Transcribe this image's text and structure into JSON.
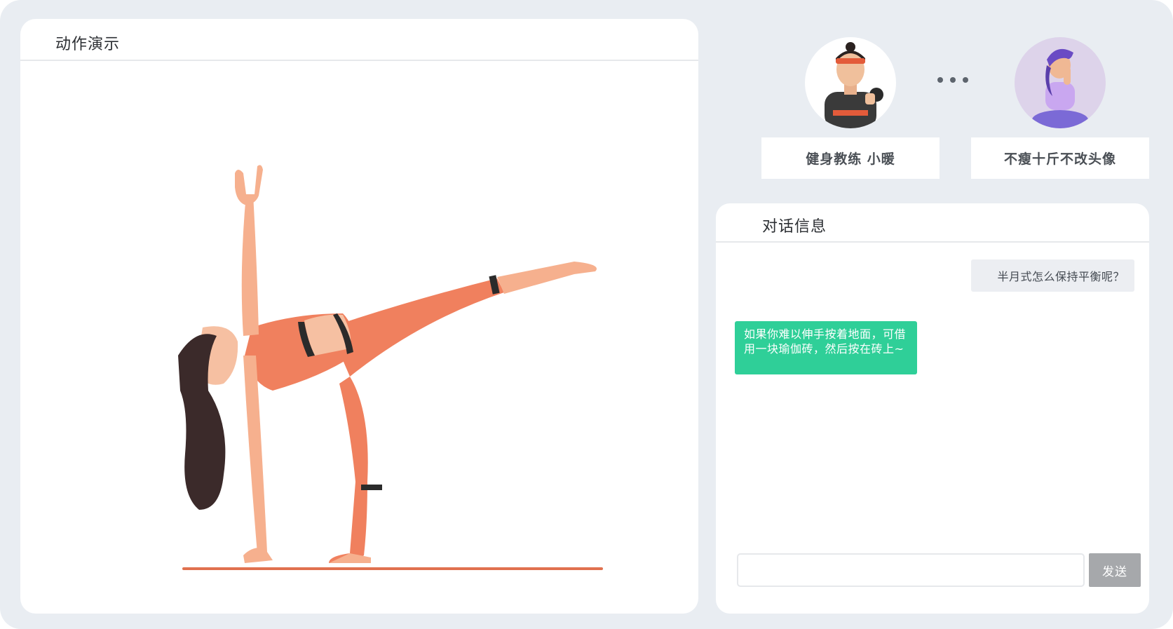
{
  "demo": {
    "title": "动作演示"
  },
  "participants": {
    "coach": {
      "name": "健身教练 小暖",
      "avatar_icon": "coach-avatar-icon"
    },
    "user": {
      "name": "不瘦十斤不改头像",
      "avatar_icon": "user-avatar-icon"
    },
    "connector_icon": "ellipsis-icon"
  },
  "chat": {
    "title": "对话信息",
    "messages": [
      {
        "sender": "user",
        "text": "半月式怎么保持平衡呢？"
      },
      {
        "sender": "coach",
        "text": "如果你难以伸手按着地面，可借用一块瑜伽砖，然后按在砖上~"
      }
    ],
    "input": {
      "value": "",
      "placeholder": ""
    },
    "send_label": "发送"
  },
  "colors": {
    "background": "#e9edf2",
    "panel": "#ffffff",
    "coach_bubble": "#2fcf98",
    "user_bubble": "#eceef2",
    "send_button": "#a6a8ab",
    "figure_outfit": "#f0805e"
  }
}
